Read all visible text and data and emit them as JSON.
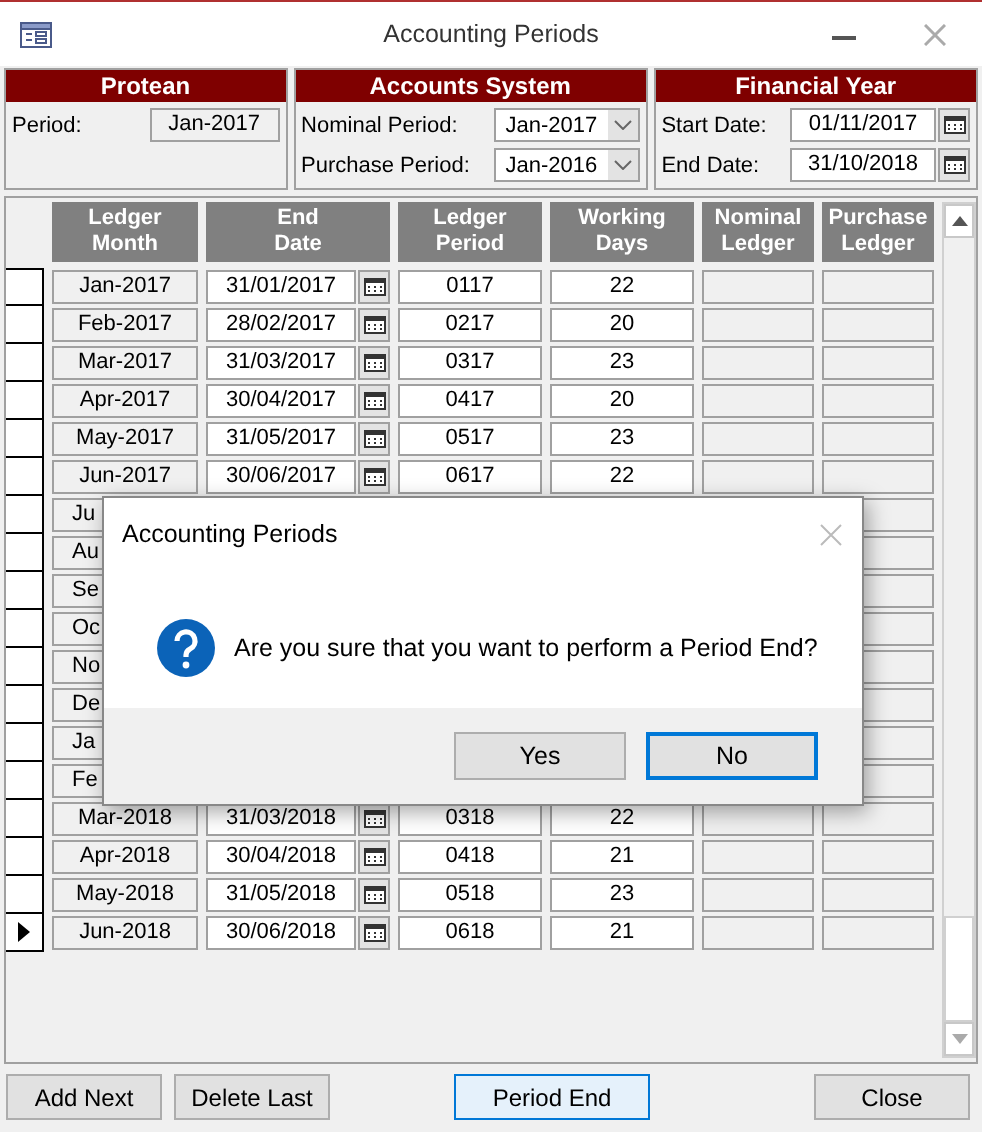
{
  "window": {
    "title": "Accounting Periods"
  },
  "panels": [
    {
      "title": "Protean",
      "fields": [
        {
          "kind": "readonly",
          "label": "Period:",
          "value": "Jan-2017"
        }
      ]
    },
    {
      "title": "Accounts System",
      "fields": [
        {
          "kind": "combo",
          "label": "Nominal Period:",
          "value": "Jan-2017"
        },
        {
          "kind": "combo",
          "label": "Purchase Period:",
          "value": "Jan-2016"
        }
      ]
    },
    {
      "title": "Financial Year",
      "fields": [
        {
          "kind": "date",
          "label": "Start Date:",
          "value": "01/11/2017"
        },
        {
          "kind": "date",
          "label": "End Date:",
          "value": "31/10/2018"
        }
      ]
    }
  ],
  "table": {
    "columns": [
      "Ledger Month",
      "End Date",
      "Ledger Period",
      "Working Days",
      "Nominal Ledger",
      "Purchase Ledger"
    ],
    "rows": [
      {
        "kind": "full",
        "current": false,
        "month": "Jan-2017",
        "end_date": "31/01/2017",
        "period": "0117",
        "days": "22"
      },
      {
        "kind": "full",
        "current": false,
        "month": "Feb-2017",
        "end_date": "28/02/2017",
        "period": "0217",
        "days": "20"
      },
      {
        "kind": "full",
        "current": false,
        "month": "Mar-2017",
        "end_date": "31/03/2017",
        "period": "0317",
        "days": "23"
      },
      {
        "kind": "full",
        "current": false,
        "month": "Apr-2017",
        "end_date": "30/04/2017",
        "period": "0417",
        "days": "20"
      },
      {
        "kind": "full",
        "current": false,
        "month": "May-2017",
        "end_date": "31/05/2017",
        "period": "0517",
        "days": "23"
      },
      {
        "kind": "full",
        "current": false,
        "month": "Jun-2017",
        "end_date": "30/06/2017",
        "period": "0617",
        "days": "22"
      },
      {
        "kind": "covered",
        "current": false,
        "month": "Ju"
      },
      {
        "kind": "covered",
        "current": false,
        "month": "Au"
      },
      {
        "kind": "covered",
        "current": false,
        "month": "Se"
      },
      {
        "kind": "covered",
        "current": false,
        "month": "Oc"
      },
      {
        "kind": "covered",
        "current": false,
        "month": "No"
      },
      {
        "kind": "covered",
        "current": false,
        "month": "De"
      },
      {
        "kind": "covered",
        "current": false,
        "month": "Ja"
      },
      {
        "kind": "covered",
        "current": false,
        "month": "Fe"
      },
      {
        "kind": "full",
        "current": false,
        "month": "Mar-2018",
        "end_date": "31/03/2018",
        "period": "0318",
        "days": "22"
      },
      {
        "kind": "full",
        "current": false,
        "month": "Apr-2018",
        "end_date": "30/04/2018",
        "period": "0418",
        "days": "21"
      },
      {
        "kind": "full",
        "current": false,
        "month": "May-2018",
        "end_date": "31/05/2018",
        "period": "0518",
        "days": "23"
      },
      {
        "kind": "full",
        "current": true,
        "month": "Jun-2018",
        "end_date": "30/06/2018",
        "period": "0618",
        "days": "21"
      }
    ]
  },
  "buttons": [
    {
      "label": "Add Next",
      "focused": false
    },
    {
      "label": "Delete Last",
      "focused": false
    },
    {
      "label": "Period End",
      "focused": true
    },
    {
      "label": "Close",
      "focused": false
    }
  ],
  "dialog": {
    "title": "Accounting Periods",
    "message": "Are you sure that you want to perform a Period End?",
    "buttons": [
      {
        "label": "Yes",
        "default": false
      },
      {
        "label": "No",
        "default": true
      }
    ]
  }
}
